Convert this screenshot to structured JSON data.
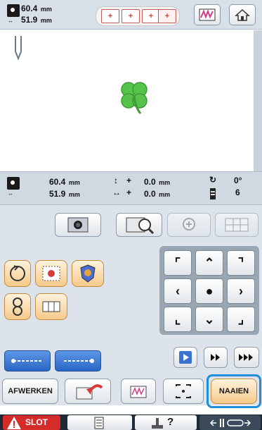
{
  "top": {
    "width_value": "60.4",
    "height_value": "51.9",
    "unit": "mm",
    "frame_plus": "+",
    "frame_plus_active": "+"
  },
  "info": {
    "width_value": "60.4",
    "height_value": "51.9",
    "unit": "mm",
    "vertical_prefix": "+",
    "vertical_value": "0.0",
    "horizontal_prefix": "+",
    "horizontal_value": "0.0",
    "angle": "0°",
    "thread_count": "6"
  },
  "buttons": {
    "afwerken": "AFWERKEN",
    "naaien": "NAAIEN",
    "slot": "SLOT",
    "help_symbol": "?"
  },
  "colors": {
    "clover_green": "#55c24a",
    "naaien_highlight": "#1e8fd8",
    "slot_red": "#d62b2b"
  }
}
